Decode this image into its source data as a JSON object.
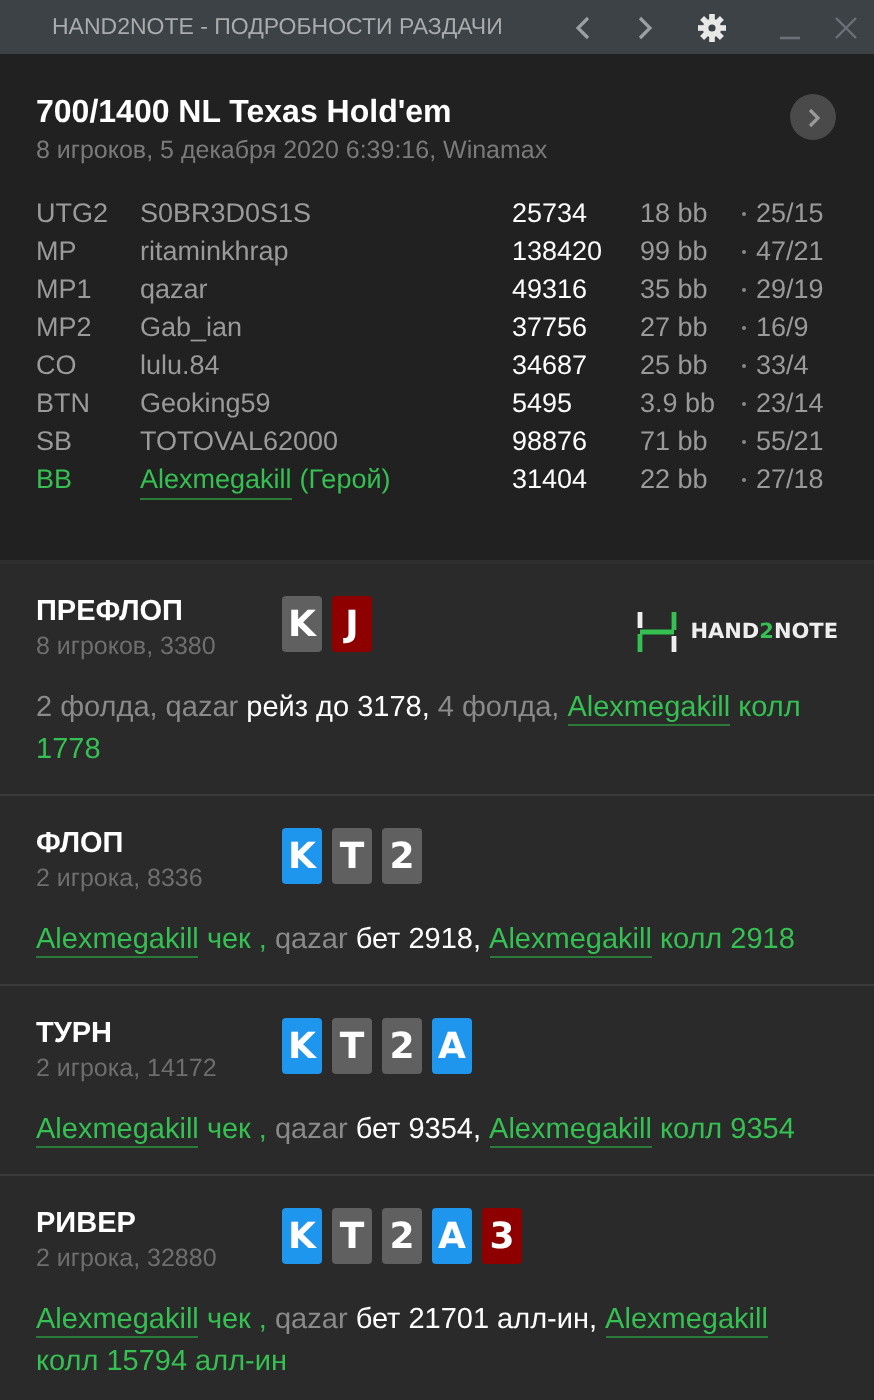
{
  "window": {
    "title": "HAND2NOTE - ПОДРОБНОСТИ РАЗДАЧИ"
  },
  "hand": {
    "title": "700/1400 NL Texas Hold'em",
    "subtitle": "8 игроков, 5 декабря 2020 6:39:16, Winamax"
  },
  "players": [
    {
      "position": "UTG2",
      "name": "S0BR3D0S1S",
      "hero": false,
      "stack": "25734",
      "bb": "18 bb",
      "stats": "25/15"
    },
    {
      "position": "MP",
      "name": "ritaminkhrap",
      "hero": false,
      "stack": "138420",
      "bb": "99 bb",
      "stats": "47/21"
    },
    {
      "position": "MP1",
      "name": "qazar",
      "hero": false,
      "stack": "49316",
      "bb": "35 bb",
      "stats": "29/19"
    },
    {
      "position": "MP2",
      "name": "Gab_ian",
      "hero": false,
      "stack": "37756",
      "bb": "27 bb",
      "stats": "16/9"
    },
    {
      "position": "CO",
      "name": "lulu.84",
      "hero": false,
      "stack": "34687",
      "bb": "25 bb",
      "stats": "33/4"
    },
    {
      "position": "BTN",
      "name": "Geoking59",
      "hero": false,
      "stack": "5495",
      "bb": "3.9 bb",
      "stats": "23/14"
    },
    {
      "position": "SB",
      "name": "TOTOVAL62000",
      "hero": false,
      "stack": "98876",
      "bb": "71 bb",
      "stats": "55/21"
    },
    {
      "position": "BB",
      "name": "Alexmegakill",
      "hero": true,
      "hero_tag": "(Герой)",
      "stack": "31404",
      "bb": "22 bb",
      "stats": "27/18"
    }
  ],
  "logo": {
    "parts": [
      {
        "text": "HAND",
        "accent": false
      },
      {
        "text": "2",
        "accent": true
      },
      {
        "text": "NOTE",
        "accent": false
      }
    ]
  },
  "streets": [
    {
      "name": "ПРЕФЛОП",
      "info": "8 игроков, 3380",
      "cards": [
        {
          "rank": "K",
          "color": "#606060"
        },
        {
          "rank": "J",
          "color": "#8e0000"
        }
      ],
      "actions": [
        {
          "kind": "fold",
          "text": "2 фолда,"
        },
        {
          "kind": "villain",
          "player": "qazar",
          "action": "рейз до 3178,"
        },
        {
          "kind": "fold",
          "text": "4 фолда,"
        },
        {
          "kind": "hero",
          "player": "Alexmegakill",
          "action": "колл 1778"
        }
      ]
    },
    {
      "name": "ФЛОП",
      "info": "2 игрока, 8336",
      "cards": [
        {
          "rank": "K",
          "color": "#1f96ee"
        },
        {
          "rank": "T",
          "color": "#606060"
        },
        {
          "rank": "2",
          "color": "#606060"
        }
      ],
      "actions": [
        {
          "kind": "hero",
          "player": "Alexmegakill",
          "action": "чек ,"
        },
        {
          "kind": "villain",
          "player": "qazar",
          "action": "бет 2918,"
        },
        {
          "kind": "hero",
          "player": "Alexmegakill",
          "action": "колл 2918"
        }
      ]
    },
    {
      "name": "ТУРН",
      "info": "2 игрока, 14172",
      "cards": [
        {
          "rank": "K",
          "color": "#1f96ee"
        },
        {
          "rank": "T",
          "color": "#606060"
        },
        {
          "rank": "2",
          "color": "#606060"
        },
        {
          "rank": "A",
          "color": "#1f96ee"
        }
      ],
      "actions": [
        {
          "kind": "hero",
          "player": "Alexmegakill",
          "action": "чек ,"
        },
        {
          "kind": "villain",
          "player": "qazar",
          "action": "бет 9354,"
        },
        {
          "kind": "hero",
          "player": "Alexmegakill",
          "action": "колл 9354"
        }
      ]
    },
    {
      "name": "РИВЕР",
      "info": "2 игрока, 32880",
      "cards": [
        {
          "rank": "K",
          "color": "#1f96ee"
        },
        {
          "rank": "T",
          "color": "#606060"
        },
        {
          "rank": "2",
          "color": "#606060"
        },
        {
          "rank": "A",
          "color": "#1f96ee"
        },
        {
          "rank": "3",
          "color": "#8e0000"
        }
      ],
      "actions": [
        {
          "kind": "hero",
          "player": "Alexmegakill",
          "action": "чек ,"
        },
        {
          "kind": "villain",
          "player": "qazar",
          "action": "бет 21701 алл-ин,"
        },
        {
          "kind": "hero",
          "player": "Alexmegakill",
          "action": "колл 15794 алл-ин"
        }
      ]
    }
  ]
}
